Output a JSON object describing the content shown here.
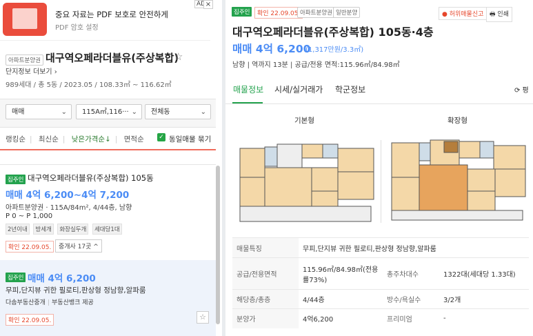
{
  "ad": {
    "title": "중요 자료는 PDF 보호로 안전하게",
    "subtitle": "PDF 암호 설정",
    "badge": "AD",
    "close": "×"
  },
  "complex": {
    "type_tag": "아파트분양권",
    "name": "대구역오페라더블유(주상복합)",
    "star": "☆",
    "detail_link": "단지정보 더보기 ›",
    "info": "989세대 / 총 5동 / 2023.05 / 108.33㎡ ~ 116.62㎡"
  },
  "filters": {
    "trade": "매매",
    "area": "115A㎡,116···",
    "dong": "전체동",
    "chevron": "⌄"
  },
  "sort": {
    "items": [
      "랭킹순",
      "최신순",
      "낮은가격순↓",
      "면적순"
    ],
    "same_listing_check": "✓",
    "same_listing_label": "동일매물 묶기"
  },
  "listing1": {
    "tag": "집주인",
    "name": "대구역오페라더블유(주상복합) 105동",
    "price": "매매 4억 6,200~4억 7,200",
    "detail": "아파트분양권 · 115A/84m², 4/44층, 남향",
    "pyeong": "P 0 ~ P 1,000",
    "pills": [
      "2년이내",
      "방세개",
      "화장실두개",
      "세대당1대"
    ],
    "confirmed": "확인 22.09.05.",
    "broker": "중개사 17곳 ^"
  },
  "listing2": {
    "tag": "집주인",
    "price": "매매 4억 6,200",
    "feature": "무피,단지뷰 귀한 필로티,판상형 정남향,알파룸",
    "agent": "다솜부동산중개",
    "agent_sep": "|",
    "provider": "부동산뱅크 제공",
    "confirmed": "확인 22.09.05.",
    "star": "☆"
  },
  "detail": {
    "tag": "집주인",
    "confirmed": "확인 22.09.05.",
    "tag2": "아파트분양권",
    "tag3": "일반분양",
    "report": "● 허위매물신고",
    "print": "🖶 인쇄",
    "title": "대구역오페라더블유(주상복합) 105동·4층",
    "price": "매매 4억 6,200",
    "price_unit": "(1,317만원/3.3㎡)",
    "info": "남향 | 역까지 13분 | 공급/전용 면적:115.96㎡/84.98㎡",
    "tabs": [
      "매물정보",
      "시세/실거래가",
      "학군정보"
    ],
    "tab_edge": "⟳ 평",
    "floorplan_basic": "기본형",
    "floorplan_ext": "확장형",
    "specs": [
      {
        "k1": "매물특징",
        "v1": "무피,단지뷰 귀한 필로티,판상형 정남향,알파룸",
        "k2": "",
        "v2": ""
      },
      {
        "k1": "공급/전용면적",
        "v1": "115.96㎡/84.98㎡(전용률73%)",
        "k2": "총주차대수",
        "v2": "1322대(세대당 1.33대)"
      },
      {
        "k1": "해당층/총층",
        "v1": "4/44층",
        "k2": "방수/욕실수",
        "v2": "3/2개"
      },
      {
        "k1": "분양가",
        "v1": "4억6,200",
        "k2": "프리미엄",
        "v2": "-"
      }
    ]
  }
}
